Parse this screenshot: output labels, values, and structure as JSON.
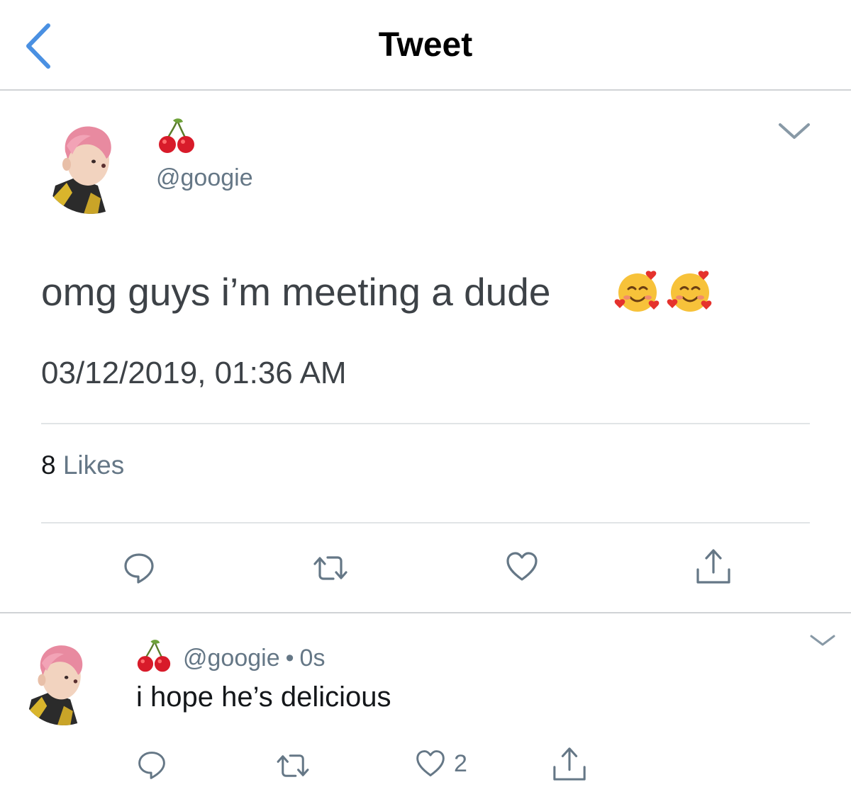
{
  "nav": {
    "title": "Tweet"
  },
  "tweet": {
    "name_emoji": "cherry-icon",
    "handle": "@googie",
    "text": "omg guys i’m meeting a dude",
    "emojis": [
      "smiling-face-with-hearts-icon",
      "smiling-face-with-hearts-icon"
    ],
    "timestamp": "03/12/2019, 01:36 AM",
    "likes_count": "8",
    "likes_label": "Likes"
  },
  "reply": {
    "handle": "@googie",
    "separator": "•",
    "time": "0s",
    "text": "i hope he’s delicious",
    "like_count": "2"
  },
  "colors": {
    "accent": "#4a90e2",
    "muted": "#657786",
    "icon": "#657786"
  }
}
